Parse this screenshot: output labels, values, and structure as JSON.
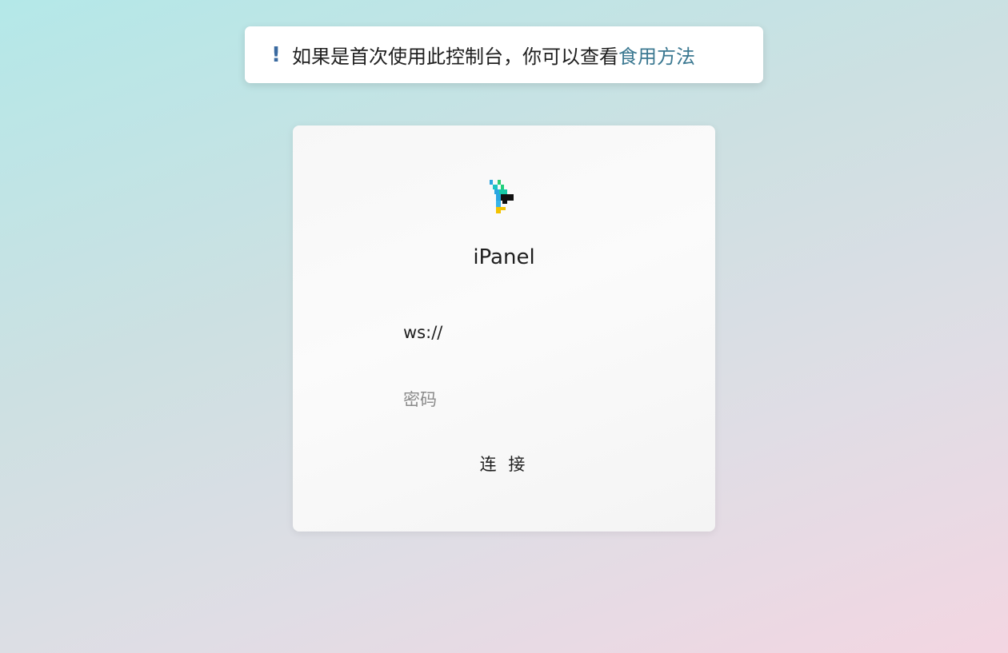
{
  "notice": {
    "icon": "exclamation-icon",
    "icon_glyph": "!",
    "text": "如果是首次使用此控制台，你可以查看",
    "link_label": "食用方法",
    "link_color": "#3b7891"
  },
  "login": {
    "logo_icon": "ipanel-logo-icon",
    "title": "iPanel",
    "url_value": "ws://",
    "password_placeholder": "密码",
    "connect_label": "连 接"
  }
}
